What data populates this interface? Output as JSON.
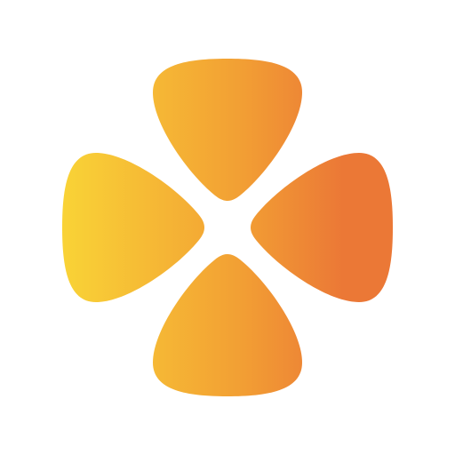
{
  "logo": {
    "icon": "four-petal-logo-icon",
    "colors": {
      "gradient_start": "#F9D336",
      "gradient_end": "#EB7836",
      "background": "#FFFFFF"
    }
  }
}
